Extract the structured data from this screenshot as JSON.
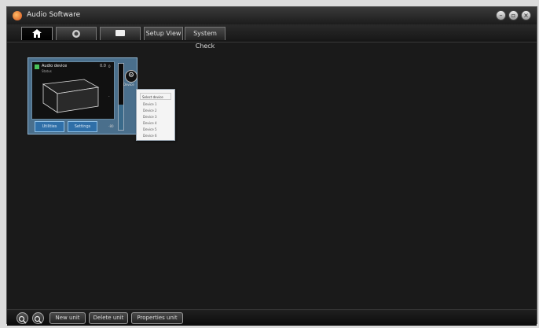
{
  "app": {
    "title": "Audio Software"
  },
  "window_controls": {
    "minimize": "–",
    "maximize": "▫",
    "close": "×"
  },
  "tabs": {
    "home_icon": "home-icon",
    "tab2_icon": "record-icon",
    "tab3_icon": "display-icon",
    "tab4_label": "Setup View",
    "tab5_label": "System Check"
  },
  "device_card": {
    "title": "Audio device",
    "subtitle": "Status",
    "readout": "0.0",
    "meter_top": "0",
    "meter_mid": "-",
    "meter_bottom": "-80",
    "meter_level": 0.38,
    "tab_left": "Utilities",
    "tab_right": "Settings"
  },
  "device_menu": {
    "caption": "Device",
    "header": "Select device",
    "items": [
      "Device 1",
      "Device 2",
      "Device 3",
      "Device 4",
      "Device 5",
      "Device 6"
    ]
  },
  "bottombar": {
    "zoom_in_icon": "zoom-in-icon",
    "zoom_out_icon": "zoom-out-icon",
    "btn1": "New unit",
    "btn2": "Delete unit",
    "btn3": "Properties unit"
  },
  "colors": {
    "accent": "#4a6f8c",
    "status": "#49c25a"
  }
}
